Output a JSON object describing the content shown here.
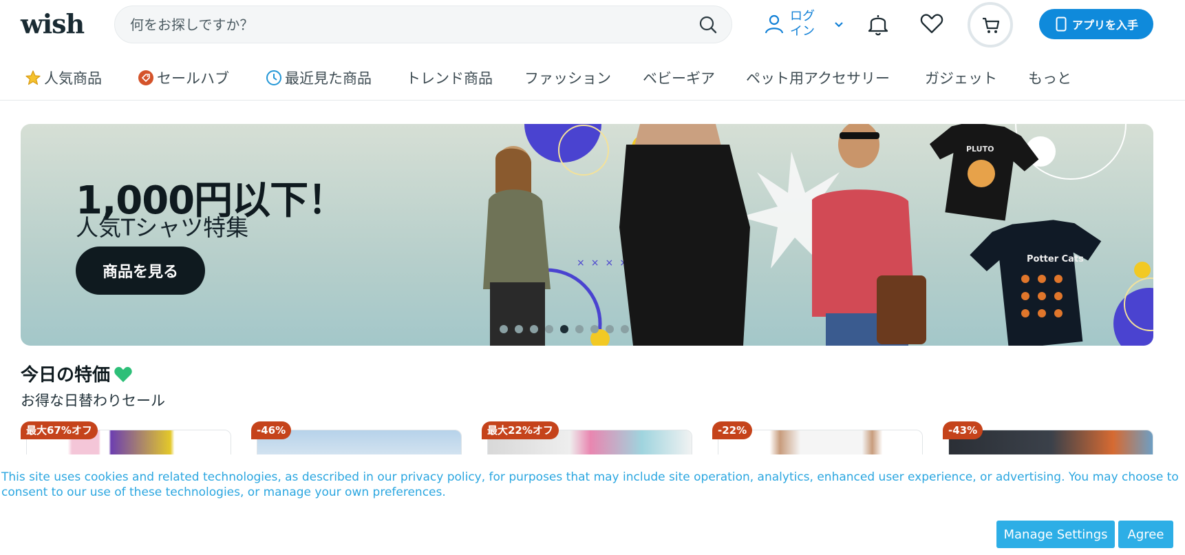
{
  "header": {
    "logo": "wish",
    "search_placeholder": "何をお探しですか？",
    "login_label": "ログイン",
    "get_app_label": "アプリを入手"
  },
  "nav": {
    "items": [
      {
        "label": "人気商品",
        "icon": "star-icon"
      },
      {
        "label": "セールハブ",
        "icon": "tag-icon"
      },
      {
        "label": "最近見た商品",
        "icon": "clock-icon"
      },
      {
        "label": "トレンド商品"
      },
      {
        "label": "ファッション"
      },
      {
        "label": "ベビーギア"
      },
      {
        "label": "ペット用アクセサリー"
      },
      {
        "label": "ガジェット"
      },
      {
        "label": "もっと"
      }
    ]
  },
  "banner": {
    "title": "1,000円以下！",
    "subtitle": "人気Tシャツ特集",
    "cta_label": "商品を見る",
    "tshirt_1_text": "PLUTO",
    "tshirt_2_text": "Potter Cats",
    "slide_count": 9,
    "active_slide": 4
  },
  "deals": {
    "title": "今日の特価",
    "subtitle": "お得な日替わりセール",
    "badges": [
      "最大67%オフ",
      "-46%",
      "最大22%オフ",
      "-22%",
      "-43%"
    ]
  },
  "cookie": {
    "text": "This site uses cookies and related technologies, as described in our privacy policy, for purposes that may include site operation, analytics, enhanced user experience, or advertising. You may choose to consent to our use of these technologies, or manage your own preferences.",
    "manage_label": "Manage Settings",
    "agree_label": "Agree"
  },
  "colors": {
    "brand_blue": "#0f8adb",
    "badge_red": "#c5431b",
    "cookie_blue": "#2daee6"
  }
}
